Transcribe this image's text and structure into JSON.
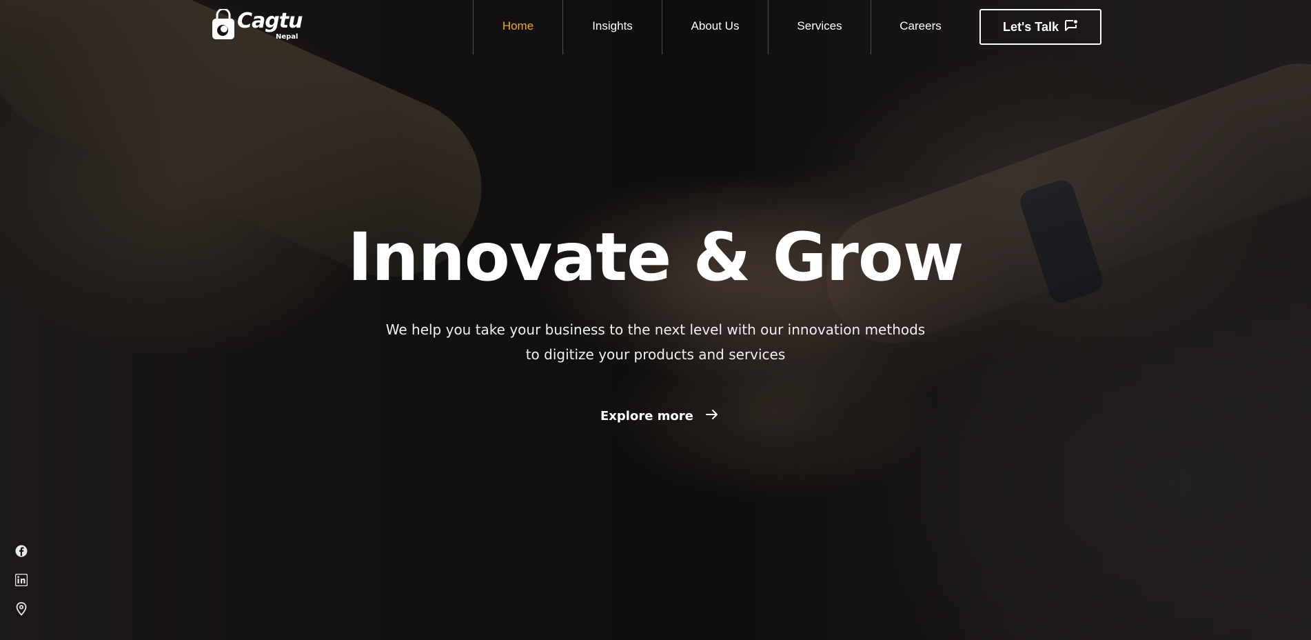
{
  "brand": {
    "name": "Cagtu",
    "subtitle": "Nepal",
    "accent_color": "#f0a91a"
  },
  "nav": {
    "items": [
      {
        "label": "Home",
        "active": true
      },
      {
        "label": "Insights",
        "active": false
      },
      {
        "label": "About Us",
        "active": false
      },
      {
        "label": "Services",
        "active": false
      },
      {
        "label": "Careers",
        "active": false
      }
    ],
    "cta_label": "Let's Talk",
    "cta_icon": "chat-icon"
  },
  "hero": {
    "title": "Innovate & Grow",
    "subtitle_line1": "We help you take your business to the next level with our innovation methods",
    "subtitle_line2": "to digitize your products and services",
    "explore_label": "Explore more",
    "explore_icon": "arrow-right-icon"
  },
  "social": {
    "icons": [
      "facebook-icon",
      "linkedin-icon",
      "location-pin-icon"
    ]
  }
}
